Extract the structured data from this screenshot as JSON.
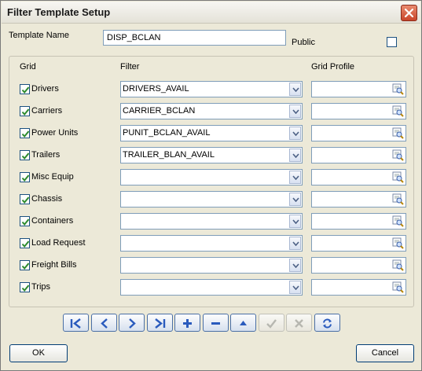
{
  "window": {
    "title": "Filter Template Setup"
  },
  "template": {
    "name_label": "Template Name",
    "name_value": "DISP_BCLAN",
    "public_label": "Public",
    "public_checked": false
  },
  "headers": {
    "grid": "Grid",
    "filter": "Filter",
    "profile": "Grid Profile"
  },
  "rows": [
    {
      "grid": "Drivers",
      "checked": true,
      "filter": "DRIVERS_AVAIL",
      "profile": ""
    },
    {
      "grid": "Carriers",
      "checked": true,
      "filter": "CARRIER_BCLAN",
      "profile": ""
    },
    {
      "grid": "Power Units",
      "checked": true,
      "filter": "PUNIT_BCLAN_AVAIL",
      "profile": ""
    },
    {
      "grid": "Trailers",
      "checked": true,
      "filter": "TRAILER_BLAN_AVAIL",
      "profile": ""
    },
    {
      "grid": "Misc Equip",
      "checked": true,
      "filter": "",
      "profile": ""
    },
    {
      "grid": "Chassis",
      "checked": true,
      "filter": "",
      "profile": ""
    },
    {
      "grid": "Containers",
      "checked": true,
      "filter": "",
      "profile": ""
    },
    {
      "grid": "Load Request",
      "checked": true,
      "filter": "",
      "profile": ""
    },
    {
      "grid": "Freight Bills",
      "checked": true,
      "filter": "",
      "profile": ""
    },
    {
      "grid": "Trips",
      "checked": true,
      "filter": "",
      "profile": ""
    }
  ],
  "navigator": [
    {
      "name": "first-record-button",
      "icon": "first-icon",
      "enabled": true
    },
    {
      "name": "prior-record-button",
      "icon": "prior-icon",
      "enabled": true
    },
    {
      "name": "next-record-button",
      "icon": "next-icon",
      "enabled": true
    },
    {
      "name": "last-record-button",
      "icon": "last-icon",
      "enabled": true
    },
    {
      "name": "insert-record-button",
      "icon": "plus-icon",
      "enabled": true
    },
    {
      "name": "delete-record-button",
      "icon": "minus-icon",
      "enabled": true
    },
    {
      "name": "edit-record-button",
      "icon": "edit-triangle-icon",
      "enabled": true
    },
    {
      "name": "post-edit-button",
      "icon": "check-icon",
      "enabled": false
    },
    {
      "name": "cancel-edit-button",
      "icon": "x-icon",
      "enabled": false
    },
    {
      "name": "refresh-button",
      "icon": "refresh-icon",
      "enabled": true
    }
  ],
  "buttons": {
    "ok": "OK",
    "cancel": "Cancel"
  },
  "colors": {
    "nav_icon": "#2a5bbd",
    "check": "#2c8a2c",
    "close_button": "#c9452a"
  }
}
